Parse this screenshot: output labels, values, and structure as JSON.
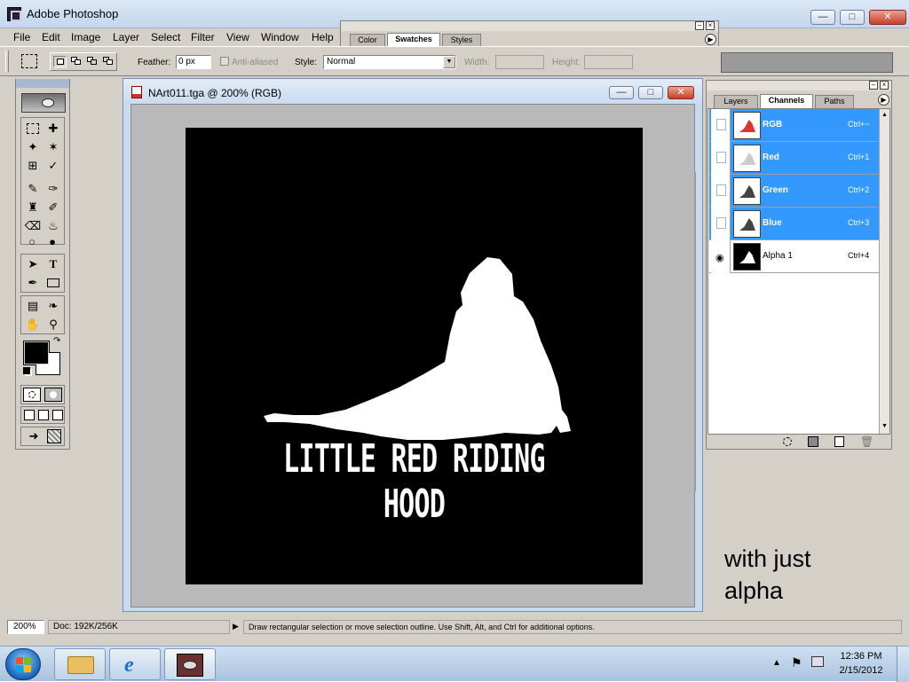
{
  "window": {
    "title": "Adobe Photoshop"
  },
  "menu": [
    "File",
    "Edit",
    "Image",
    "Layer",
    "Select",
    "Filter",
    "View",
    "Window",
    "Help"
  ],
  "options": {
    "feather_label": "Feather:",
    "feather_value": "0 px",
    "antialiased_label": "Anti-aliased",
    "style_label": "Style:",
    "style_value": "Normal",
    "width_label": "Width:",
    "height_label": "Height:"
  },
  "swatches_panel": {
    "tabs": [
      "Color",
      "Swatches",
      "Styles"
    ],
    "active_tab": "Swatches"
  },
  "document": {
    "title": "NArt011.tga @ 200% (RGB)",
    "artwork_text": "LITTLE RED RIDING HOOD"
  },
  "channels_panel": {
    "tabs": [
      "Layers",
      "Channels",
      "Paths"
    ],
    "active_tab": "Channels",
    "channels": [
      {
        "name": "RGB",
        "shortcut": "Ctrl+~",
        "selected": true,
        "visible": false
      },
      {
        "name": "Red",
        "shortcut": "Ctrl+1",
        "selected": true,
        "visible": false
      },
      {
        "name": "Green",
        "shortcut": "Ctrl+2",
        "selected": true,
        "visible": false
      },
      {
        "name": "Blue",
        "shortcut": "Ctrl+3",
        "selected": true,
        "visible": false
      },
      {
        "name": "Alpha 1",
        "shortcut": "Ctrl+4",
        "selected": false,
        "visible": true
      }
    ]
  },
  "status": {
    "zoom": "200%",
    "doc": "Doc: 192K/256K",
    "message": "Draw rectangular selection or move selection outline.  Use Shift, Alt, and Ctrl for additional options."
  },
  "annotation": {
    "line1": "with just",
    "line2": "alpha"
  },
  "taskbar": {
    "time": "12:36 PM",
    "date": "2/15/2012"
  },
  "colors": {
    "selection": "#3399ff",
    "chrome": "#d4d0c8",
    "canvas_bg": "#000000",
    "artwork": "#ffffff"
  }
}
